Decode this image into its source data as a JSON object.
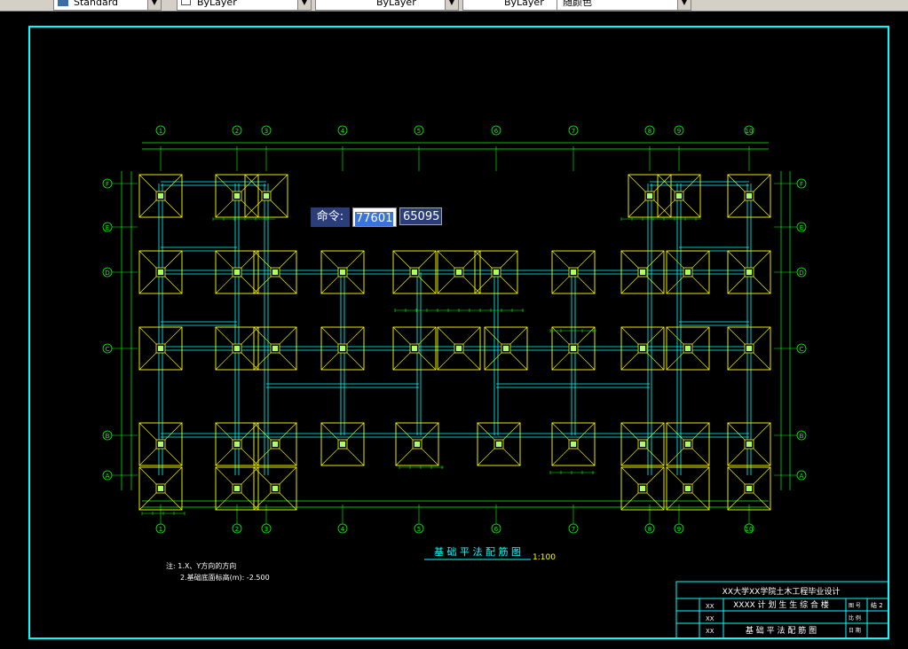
{
  "toolbar": {
    "combos": [
      {
        "value": "Standard"
      },
      {
        "value": "ByLayer"
      },
      {
        "value": "ByLayer"
      },
      {
        "value": "ByLayer"
      },
      {
        "value": "随颜色"
      }
    ]
  },
  "drawing": {
    "axis_top": [
      "1",
      "2",
      "3",
      "4",
      "5",
      "6",
      "7",
      "8",
      "9",
      "10"
    ],
    "axis_bottom": [
      "1",
      "2",
      "3",
      "4",
      "5",
      "6",
      "7",
      "8",
      "9",
      "10"
    ],
    "axis_rows": [
      "F",
      "E",
      "D",
      "C",
      "B",
      "A"
    ],
    "title": "基 础 平 法 配 筋 图",
    "scale": "1:100",
    "notes": [
      "注: 1.X、Y方向的方向",
      "2.基础底面标高(m): -2.500"
    ],
    "title_block": {
      "project": "XX大学XX学院土木工程毕业设计",
      "building": "XXXX 计 划 生 生 综 合 楼",
      "drawing": "基 础 平 法 配 筋 图",
      "sheet_label": "图 号",
      "sheet_no": "结 2",
      "date_label": "日 期",
      "scale_label": "比 例",
      "rows": [
        "XX",
        "XX",
        "XX"
      ]
    }
  },
  "command": {
    "label": "命令:",
    "x": "77601",
    "y": "65095"
  },
  "colors": {
    "background": "#000000",
    "frame": "#00ffff",
    "footing": "#ffff00",
    "beam": "#00ffff",
    "dims": "#00ff00"
  }
}
